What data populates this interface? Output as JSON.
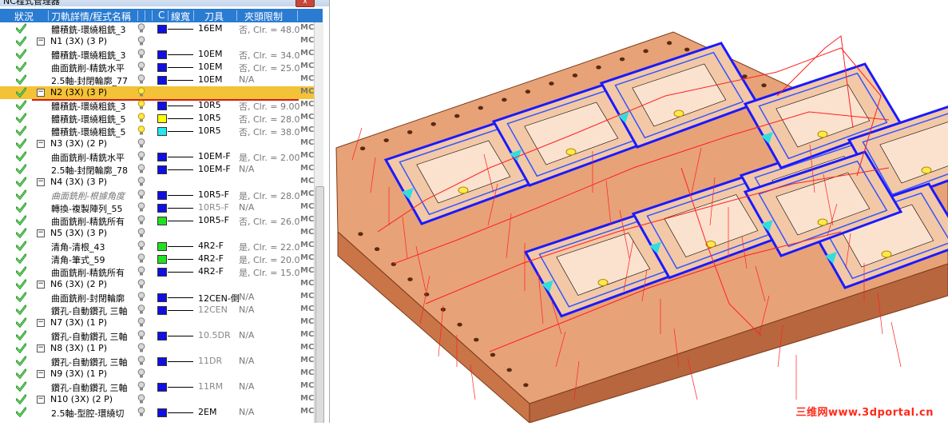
{
  "window": {
    "title": "NC程式管理器",
    "close_label": "x"
  },
  "header": {
    "status": "狀況",
    "name": "刀軌詳情/程式名稱",
    "color": "C",
    "linewidth": "線寬",
    "tool": "刀具",
    "clamp": "夾頭限制"
  },
  "rows": [
    {
      "type": "op",
      "name": "體積銑-環繞粗銑_3",
      "swatch": "#1010e0",
      "tool": "16EM",
      "clamp": "否, Clr. = 48.0",
      "mc": "MC"
    },
    {
      "type": "prog",
      "name": "N1 (3X) (3 P)",
      "mc": "MC"
    },
    {
      "type": "op",
      "name": "體積銑-環繞粗銑_3",
      "swatch": "#1010e0",
      "tool": "10EM",
      "clamp": "否, Clr. = 34.0",
      "mc": "MC"
    },
    {
      "type": "op",
      "name": "曲面銑削-精銑水平",
      "swatch": "#1010e0",
      "tool": "10EM",
      "clamp": "否, Clr. = 25.0",
      "mc": "MC"
    },
    {
      "type": "op",
      "name": "2.5軸-封閉輪廓_77",
      "swatch": "#1010e0",
      "tool": "10EM",
      "clamp": "N/A",
      "mc": "MC"
    },
    {
      "type": "prog",
      "name": "N2 (3X) (3 P)",
      "mc": "MC",
      "selected": true
    },
    {
      "type": "op",
      "name": "體積銑-環繞粗銑_3",
      "swatch": "#1010e0",
      "tool": "10R5",
      "clamp": "否, Clr. = 9.00",
      "mc": "MC",
      "bulb": "on"
    },
    {
      "type": "op",
      "name": "體積銑-環繞粗銑_5",
      "swatch": "#ffff00",
      "tool": "10R5",
      "clamp": "否, Clr. = 28.0",
      "mc": "MC",
      "bulb": "on"
    },
    {
      "type": "op",
      "name": "體積銑-環繞粗銑_5",
      "swatch": "#22e8f0",
      "tool": "10R5",
      "clamp": "否, Clr. = 38.0",
      "mc": "MC",
      "bulb": "on"
    },
    {
      "type": "prog",
      "name": "N3 (3X) (2 P)",
      "mc": "MC"
    },
    {
      "type": "op",
      "name": "曲面銑削-精銑水平",
      "swatch": "#1010e0",
      "tool": "10EM-F",
      "clamp": "是, Clr. = 2.00",
      "mc": "MC"
    },
    {
      "type": "op",
      "name": "2.5軸-封閉輪廓_78",
      "swatch": "#1010e0",
      "tool": "10EM-F",
      "clamp": "N/A",
      "mc": "MC"
    },
    {
      "type": "prog",
      "name": "N4 (3X) (3 P)",
      "mc": "MC"
    },
    {
      "type": "op",
      "name": "曲面銑削-根據角度",
      "swatch": "#1010e0",
      "tool": "10R5-F",
      "clamp": "是, Clr. = 28.0",
      "mc": "MC",
      "dim": true
    },
    {
      "type": "op",
      "name": "轉換-複製陣列_55",
      "swatch": "#1010e0",
      "tool": "10R5-F",
      "clamp": "N/A",
      "mc": "MC",
      "toolgrey": true
    },
    {
      "type": "op",
      "name": "曲面銑削-精銑所有",
      "swatch": "#22e022",
      "tool": "10R5-F",
      "clamp": "否, Clr. = 26.0",
      "mc": "MC"
    },
    {
      "type": "prog",
      "name": "N5 (3X) (3 P)",
      "mc": "MC"
    },
    {
      "type": "op",
      "name": "清角-清根_43",
      "swatch": "#22e022",
      "tool": "4R2-F",
      "clamp": "是, Clr. = 22.0",
      "mc": "MC"
    },
    {
      "type": "op",
      "name": "清角-筆式_59",
      "swatch": "#22e022",
      "tool": "4R2-F",
      "clamp": "是, Clr. = 20.0",
      "mc": "MC"
    },
    {
      "type": "op",
      "name": "曲面銑削-精銑所有",
      "swatch": "#1010e0",
      "tool": "4R2-F",
      "clamp": "是, Clr. = 15.0",
      "mc": "MC"
    },
    {
      "type": "prog",
      "name": "N6 (3X) (2 P)",
      "mc": "MC"
    },
    {
      "type": "op",
      "name": "曲面銑削-封閉輪廓",
      "swatch": "#1010e0",
      "tool": "12CEN-倒",
      "clamp": "N/A",
      "mc": "MC"
    },
    {
      "type": "op",
      "name": "鑽孔-自動鑽孔 三軸",
      "swatch": "#1010e0",
      "tool": "12CEN",
      "clamp": "N/A",
      "mc": "MC",
      "toolgrey": true
    },
    {
      "type": "prog",
      "name": "N7 (3X) (1 P)",
      "mc": "MC"
    },
    {
      "type": "op",
      "name": "鑽孔-自動鑽孔 三軸",
      "swatch": "#1010e0",
      "tool": "10.5DR",
      "clamp": "N/A",
      "mc": "MC",
      "toolgrey": true
    },
    {
      "type": "prog",
      "name": "N8 (3X) (1 P)",
      "mc": "MC"
    },
    {
      "type": "op",
      "name": "鑽孔-自動鑽孔 三軸",
      "swatch": "#1010e0",
      "tool": "11DR",
      "clamp": "N/A",
      "mc": "MC",
      "toolgrey": true
    },
    {
      "type": "prog",
      "name": "N9 (3X) (1 P)",
      "mc": "MC"
    },
    {
      "type": "op",
      "name": "鑽孔-自動鑽孔 三軸",
      "swatch": "#1010e0",
      "tool": "11RM",
      "clamp": "N/A",
      "mc": "MC",
      "toolgrey": true
    },
    {
      "type": "prog",
      "name": "N10 (3X) (2 P)",
      "mc": "MC"
    },
    {
      "type": "op",
      "name": "2.5軸-型腔-環繞切",
      "swatch": "#1010e0",
      "tool": "2EM",
      "clamp": "N/A",
      "mc": "MC"
    }
  ],
  "viewport": {
    "watermark": "三维网www.3dportal.cn",
    "colors": {
      "part": "#d98c5c",
      "part_top": "#e8a277",
      "part_side": "#c97548",
      "toolpath": "#1a1aff",
      "rapid": "#ff2020"
    }
  }
}
